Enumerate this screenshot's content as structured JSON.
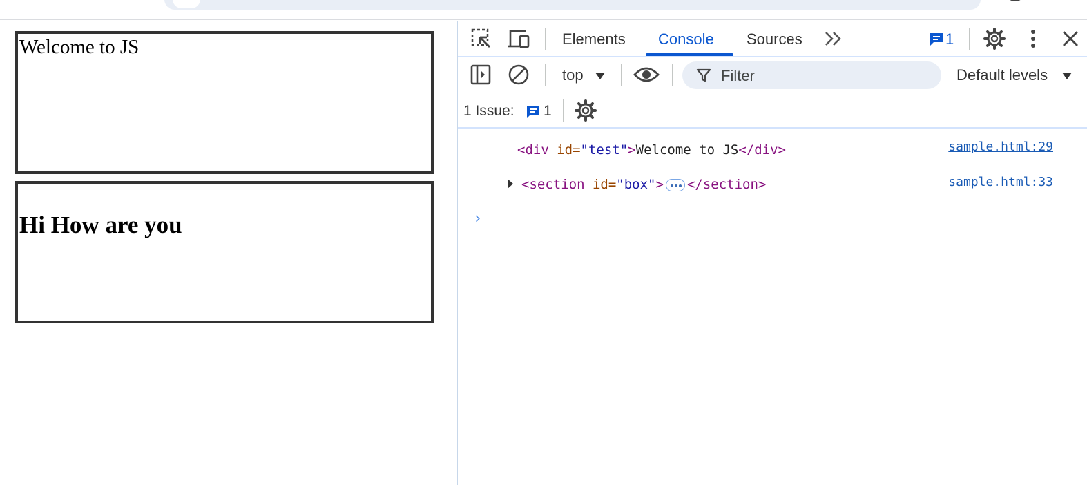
{
  "page": {
    "box1_text": "Welcome to JS",
    "box2_text": "Hi How are you"
  },
  "devtools": {
    "tabs": [
      "Elements",
      "Console",
      "Sources"
    ],
    "active_tab": "Console",
    "issues_badge_count": "1",
    "toolbar": {
      "context": "top",
      "filter_placeholder": "Filter",
      "levels": "Default levels"
    },
    "issues_bar": {
      "label": "1 Issue:",
      "count": "1"
    },
    "console_messages": [
      {
        "open_tag": "<div",
        "attr_name": " id=",
        "attr_value": "\"test\"",
        "close_bracket": ">",
        "text": "Welcome to JS",
        "end_tag": "</div>",
        "source": "sample.html:29"
      },
      {
        "open_tag": "<section",
        "attr_name": " id=",
        "attr_value": "\"box\"",
        "close_bracket": ">",
        "end_tag": "</section>",
        "source": "sample.html:33"
      }
    ],
    "prompt_symbol": "›"
  },
  "colors": {
    "accent": "#0b57d0",
    "tag": "#881280",
    "attr": "#994500",
    "value": "#1a1aa6",
    "link": "#1a5bb5"
  },
  "icons": [
    "inspect-element-icon",
    "device-toggle-icon",
    "more-tabs-icon",
    "issues-icon",
    "settings-icon",
    "kebab-menu-icon",
    "close-icon",
    "sidebar-toggle-icon",
    "clear-console-icon",
    "dropdown-caret-icon",
    "eye-icon",
    "filter-icon"
  ]
}
